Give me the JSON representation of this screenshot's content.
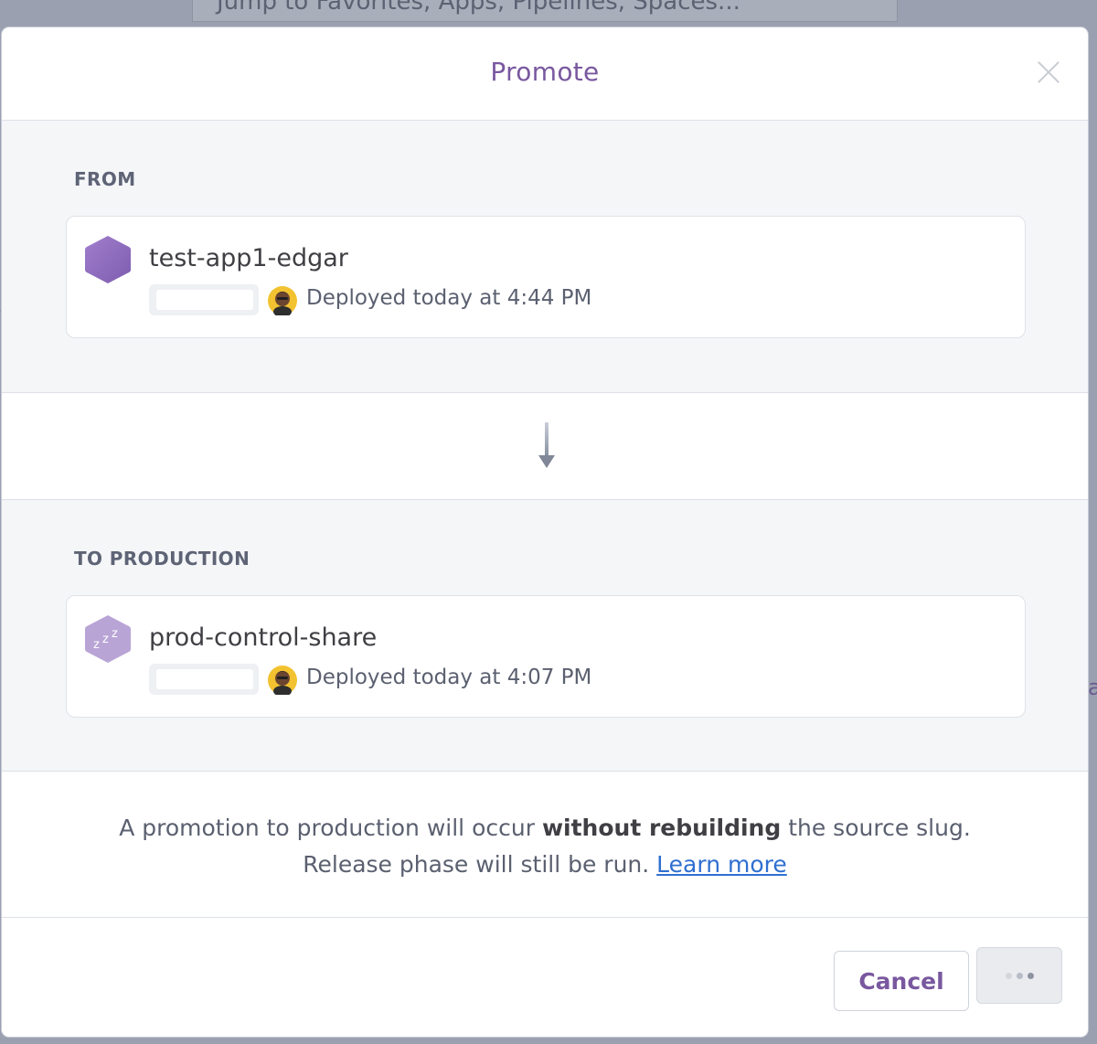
{
  "background": {
    "search_placeholder": "Jump to Favorites, Apps, Pipelines, Spaces..."
  },
  "modal": {
    "title": "Promote",
    "close_icon": "close-icon",
    "from": {
      "label": "FROM",
      "app_name": "test-app1-edgar",
      "deploy_text": "Deployed today at 4:44 PM",
      "state": "awake"
    },
    "to": {
      "label": "TO PRODUCTION",
      "app_name": "prod-control-share",
      "deploy_text": "Deployed today at 4:07 PM",
      "state": "sleeping"
    },
    "notice": {
      "part1": "A promotion to production will occur ",
      "bold": "without rebuilding",
      "part2": " the source slug.",
      "line2": "Release phase will still be run.",
      "link": "Learn more"
    },
    "buttons": {
      "cancel": "Cancel",
      "promote_state": "loading"
    }
  },
  "colors": {
    "accent": "#79589f",
    "link": "#2f6fd0",
    "app_awake": "#8b6ab8",
    "app_sleeping": "#b9a4d6"
  }
}
